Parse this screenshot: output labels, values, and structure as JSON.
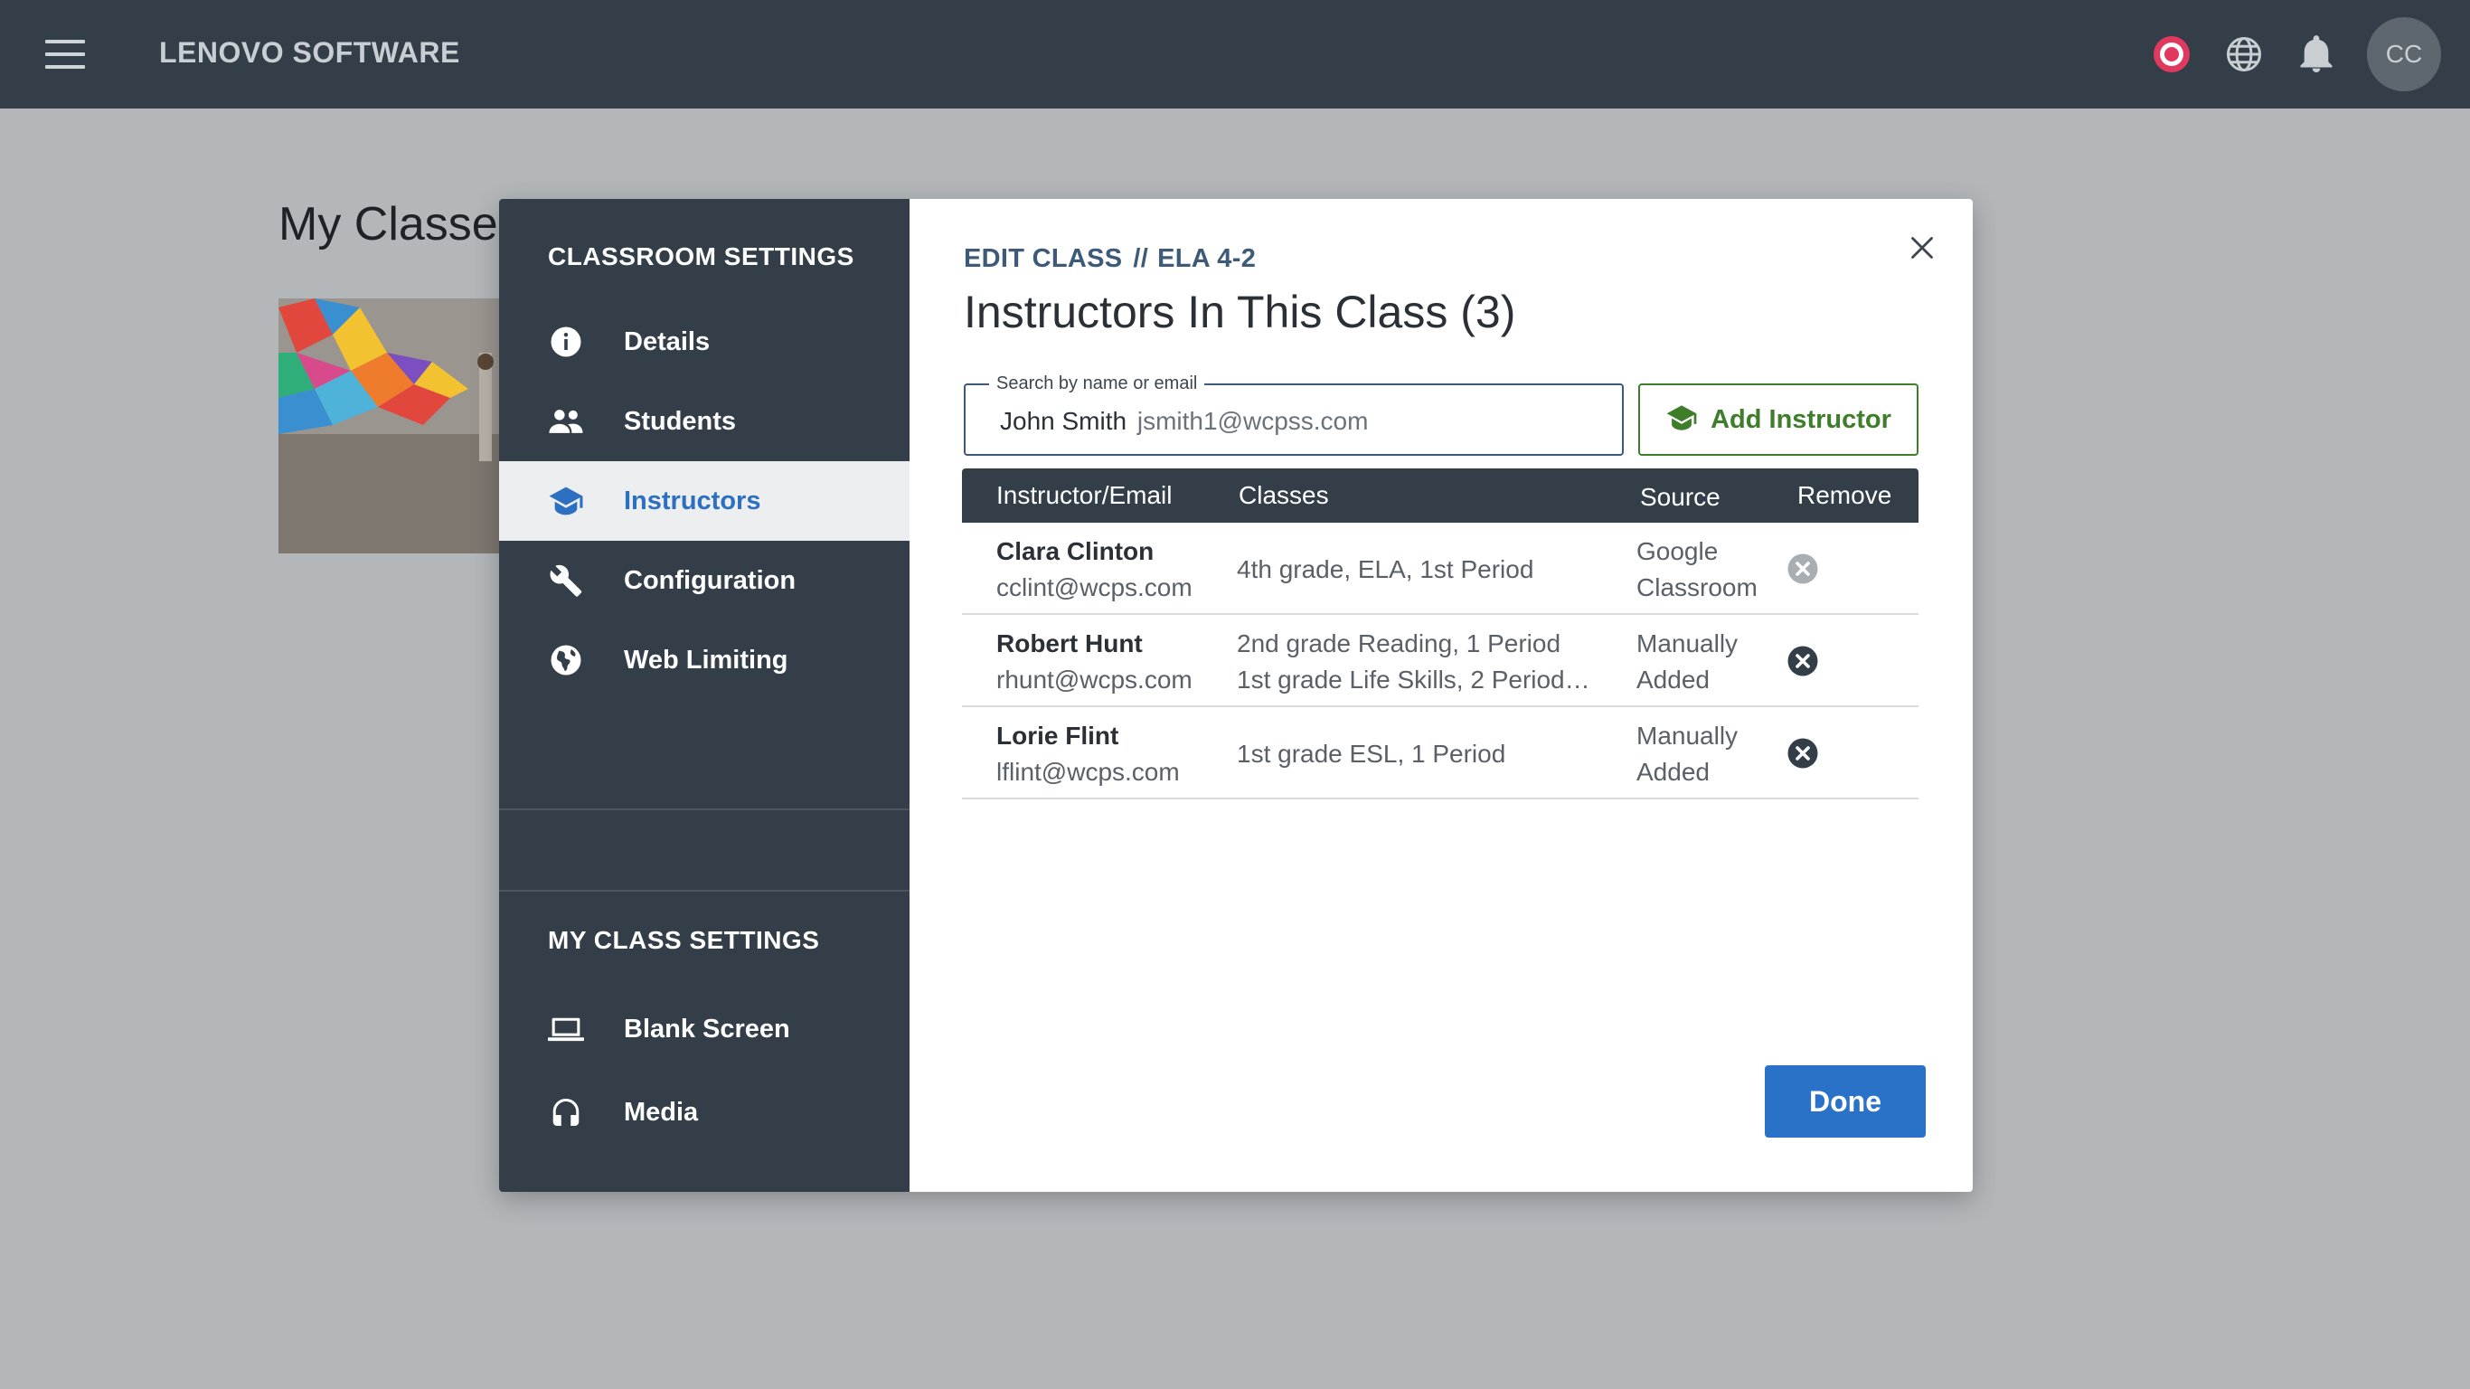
{
  "header": {
    "brand": "LENOVO SOFTWARE",
    "avatar_initials": "CC",
    "icons": [
      "menu-icon",
      "record-icon",
      "globe-icon",
      "bell-icon"
    ],
    "record_color": "#e0385e"
  },
  "page": {
    "title": "My Classes"
  },
  "sidebar": {
    "heading": "CLASSROOM SETTINGS",
    "items": [
      {
        "label": "Details",
        "icon": "info-icon"
      },
      {
        "label": "Students",
        "icon": "people-icon"
      },
      {
        "label": "Instructors",
        "icon": "graduation-cap-icon",
        "active": true
      },
      {
        "label": "Configuration",
        "icon": "wrench-icon"
      },
      {
        "label": "Web Limiting",
        "icon": "globe-icon"
      }
    ],
    "my_heading": "MY CLASS SETTINGS",
    "my_items": [
      {
        "label": "Blank Screen",
        "icon": "laptop-icon"
      },
      {
        "label": "Media",
        "icon": "headphones-icon"
      }
    ]
  },
  "main": {
    "breadcrumb_section": "EDIT CLASS",
    "breadcrumb_sep": "//",
    "breadcrumb_class": "ELA 4-2",
    "title": "Instructors In This Class (3)",
    "search": {
      "legend": "Search by name or email",
      "value_name": "John Smith",
      "value_email": "jsmith1@wcpss.com"
    },
    "add_button": "Add Instructor",
    "table": {
      "headers": [
        "Instructor/Email",
        "Classes",
        "Source",
        "Remove"
      ],
      "rows": [
        {
          "name": "Clara Clinton",
          "email": "cclint@wcps.com",
          "classes": [
            "4th grade, ELA, 1st Period"
          ],
          "source": "Google Classroom",
          "removable": false
        },
        {
          "name": "Robert Hunt",
          "email": "rhunt@wcps.com",
          "classes": [
            "2nd grade Reading, 1 Period",
            "1st grade Life Skills, 2 Period…"
          ],
          "source": "Manually Added",
          "removable": true
        },
        {
          "name": "Lorie Flint",
          "email": "lflint@wcps.com",
          "classes": [
            "1st grade ESL, 1 Period"
          ],
          "source": "Manually Added",
          "removable": true
        }
      ]
    },
    "done_button": "Done"
  },
  "colors": {
    "topbar": "#333e48",
    "accent_blue": "#2a72c8",
    "add_green": "#3e7d2a",
    "remove_active": "#333e48",
    "remove_disabled": "#a9aeb3"
  }
}
